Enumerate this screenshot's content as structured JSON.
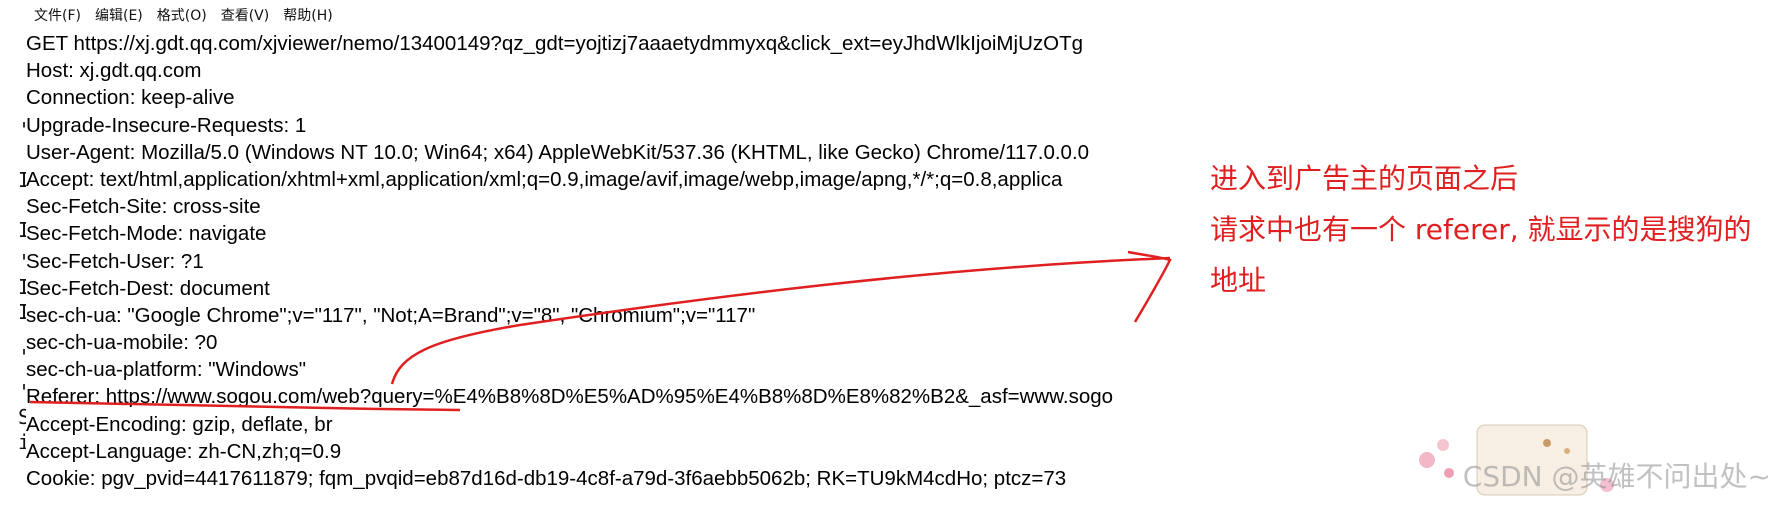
{
  "menubar": {
    "items": [
      "文件(F)",
      "编辑(E)",
      "格式(O)",
      "查看(V)",
      "帮助(H)"
    ]
  },
  "left_strip": {
    "glyphs": [
      "'",
      "I",
      "I",
      "'",
      "I",
      "I",
      "'",
      "'",
      "S",
      "i"
    ]
  },
  "request_lines": [
    "GET https://xj.gdt.qq.com/xjviewer/nemo/13400149?qz_gdt=yojtizj7aaaetydmmyxq&click_ext=eyJhdWlkIjoiMjUzOTg",
    "Host: xj.gdt.qq.com",
    "Connection: keep-alive",
    "Upgrade-Insecure-Requests: 1",
    "User-Agent: Mozilla/5.0 (Windows NT 10.0; Win64; x64) AppleWebKit/537.36 (KHTML, like Gecko) Chrome/117.0.0.0",
    "Accept: text/html,application/xhtml+xml,application/xml;q=0.9,image/avif,image/webp,image/apng,*/*;q=0.8,applica",
    "Sec-Fetch-Site: cross-site",
    "Sec-Fetch-Mode: navigate",
    "Sec-Fetch-User: ?1",
    "Sec-Fetch-Dest: document",
    "sec-ch-ua: \"Google Chrome\";v=\"117\", \"Not;A=Brand\";v=\"8\", \"Chromium\";v=\"117\"",
    "sec-ch-ua-mobile: ?0",
    "sec-ch-ua-platform: \"Windows\"",
    "Referer: https://www.sogou.com/web?query=%E4%B8%8D%E5%AD%95%E4%B8%8D%E8%82%B2&_asf=www.sogo",
    "Accept-Encoding: gzip, deflate, br",
    "Accept-Language: zh-CN,zh;q=0.9",
    "Cookie: pgv_pvid=4417611879; fqm_pvqid=eb87d16d-db19-4c8f-a79d-3f6aebb5062b; RK=TU9kM4cdHo; ptcz=73"
  ],
  "annotation": {
    "line1": "进入到广告主的页面之后",
    "line2": "请求中也有一个 referer, 就显示的是搜狗的",
    "line3": "地址",
    "color": "#e02020"
  },
  "watermark": "CSDN @英雄不问出处~"
}
